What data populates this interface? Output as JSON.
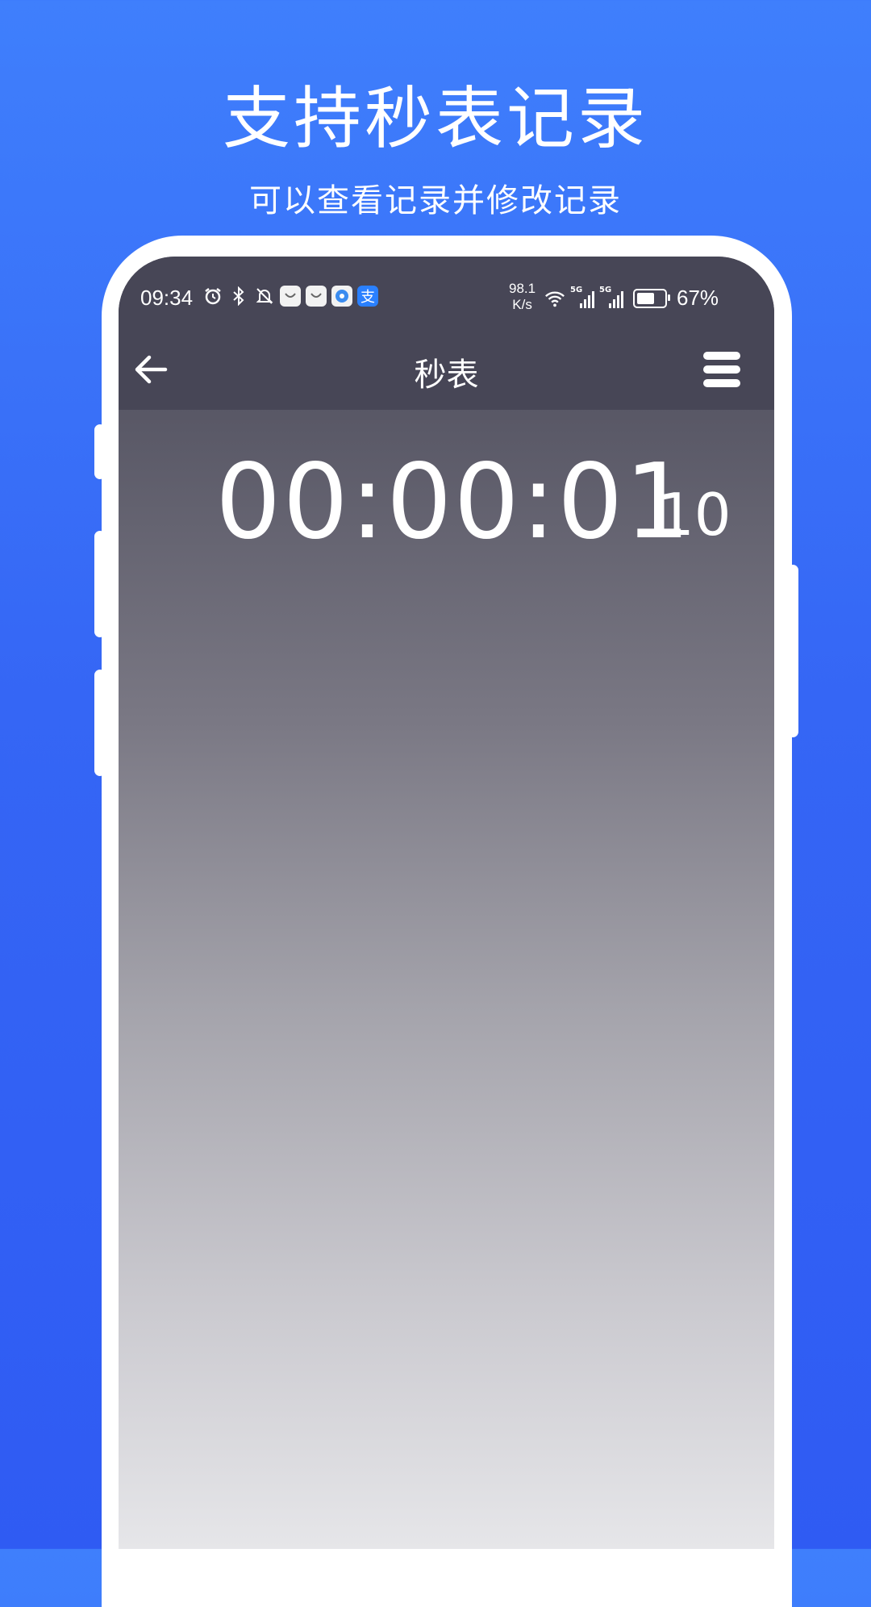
{
  "promo": {
    "title": "支持秒表记录",
    "subtitle": "可以查看记录并修改记录"
  },
  "status_bar": {
    "time": "09:34",
    "left_icons": [
      "alarm-icon",
      "bluetooth-icon",
      "mute-icon",
      "app-icon",
      "app-icon",
      "app-icon",
      "alipay-icon"
    ],
    "alipay_glyph": "支",
    "network_speed_value": "98.1",
    "network_speed_unit": "K/s",
    "signal_tag_1": "5G",
    "signal_tag_2": "5G",
    "battery_percent": "67%",
    "battery_level": 0.67
  },
  "app_bar": {
    "title": "秒表"
  },
  "stopwatch": {
    "time": "00:00:01",
    "centiseconds": "10"
  },
  "colors": {
    "background_top": "#3f7ffc",
    "background_bottom": "#2f5bf3",
    "app_bar": "#474656"
  }
}
